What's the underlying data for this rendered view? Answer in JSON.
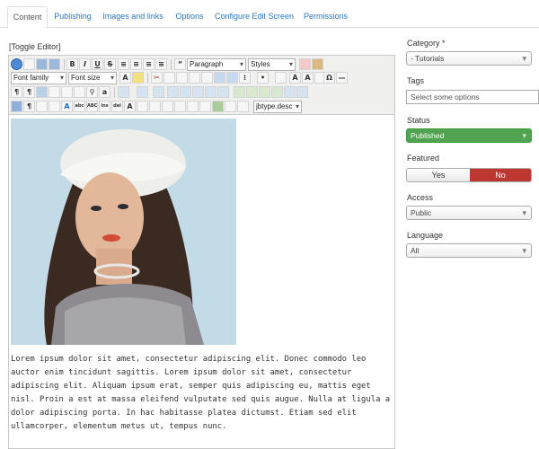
{
  "tabs": [
    {
      "label": "Content",
      "active": true
    },
    {
      "label": "Publishing"
    },
    {
      "label": "Images and links"
    },
    {
      "label": "Options"
    },
    {
      "label": "Configure Edit Screen"
    },
    {
      "label": "Permissions"
    }
  ],
  "editor": {
    "toggle_label": "[Toggle Editor]",
    "format_select": "Paragraph",
    "styles_select": "Styles",
    "font_family_select": "Font family",
    "font_size_select": "Font size",
    "jbtype_select": "jbtype.desc",
    "body_text": "Lorem ipsum dolor sit amet, consectetur adipiscing elit. Donec commodo leo auctor enim tincidunt sagittis. Lorem ipsum dolor sit amet, consectetur adipiscing elit. Aliquam ipsum erat, semper quis adipiscing eu, mattis eget nisl. Proin a est at massa eleifend vulputate sed quis augue. Nulla at ligula a dolor adipiscing porta. In hac habitasse platea dictumst. Etiam sed elit ullamcorper, elementum metus ut, tempus nunc."
  },
  "sidebar": {
    "category_label": "Category *",
    "category_value": "- Tutorials",
    "tags_label": "Tags",
    "tags_placeholder": "Select some options",
    "status_label": "Status",
    "status_value": "Published",
    "featured_label": "Featured",
    "featured_yes": "Yes",
    "featured_no": "No",
    "access_label": "Access",
    "access_value": "Public",
    "language_label": "Language",
    "language_value": "All"
  },
  "colors": {
    "link": "#2b77c0",
    "status_green": "#51a351",
    "featured_no_red": "#bd362f"
  }
}
